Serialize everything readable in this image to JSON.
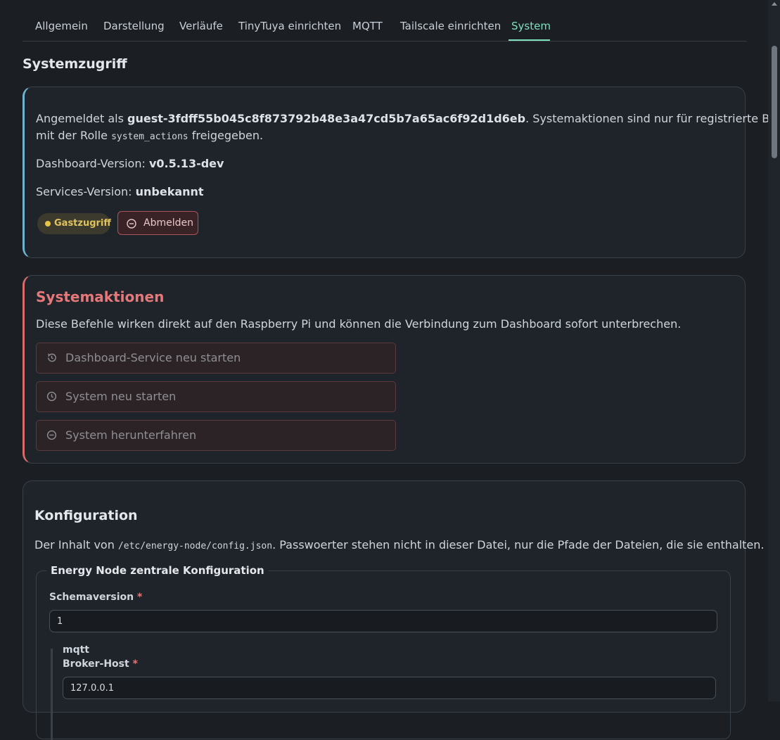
{
  "tabs": [
    {
      "label": "Allgemein",
      "active": false
    },
    {
      "label": "Darstellung",
      "active": false
    },
    {
      "label": "Verläufe",
      "active": false
    },
    {
      "label": "TinyTuya einrichten",
      "active": false
    },
    {
      "label": "MQTT",
      "active": false
    },
    {
      "label": "Tailscale einrichten",
      "active": false
    },
    {
      "label": "System",
      "active": true
    }
  ],
  "access": {
    "title": "Systemzugriff",
    "logged_in_prefix": "Angemeldet als ",
    "username": "guest-3fdff55b045c8f873792b48e3a47cd5b7a65ac6f92d1d6eb",
    "logged_in_suffix": ". Systemaktionen sind nur für registrierte Benutzer",
    "role_prefix": "mit der Rolle ",
    "role_name": "system_actions",
    "role_suffix": " freigegeben.",
    "dashboard_version_label": "Dashboard-Version: ",
    "dashboard_version": "v0.5.13-dev",
    "services_version_label": "Services-Version: ",
    "services_version": "unbekannt",
    "badge": "Gastzugriff",
    "logout_button": "Abmelden"
  },
  "actions": {
    "title": "Systemaktionen",
    "description": "Diese Befehle wirken direkt auf den Raspberry Pi und können die Verbindung zum Dashboard sofort unterbrechen.",
    "buttons": [
      {
        "label": "Dashboard-Service neu starten",
        "icon": "history-icon"
      },
      {
        "label": "System neu starten",
        "icon": "clock-icon"
      },
      {
        "label": "System herunterfahren",
        "icon": "minus-circle-icon"
      }
    ]
  },
  "config": {
    "title": "Konfiguration",
    "desc_prefix": "Der Inhalt von ",
    "path": "/etc/energy-node/config.json",
    "desc_suffix": ". Passwoerter stehen nicht in dieser Datei, nur die Pfade der Dateien, die sie enthalten.",
    "fieldset_legend": "Energy Node zentrale Konfiguration",
    "schema_label": "Schemaversion",
    "schema_value": "1",
    "mqtt_group": "mqtt",
    "broker_host_label": "Broker-Host",
    "broker_host_value": "127.0.0.1",
    "required_mark": "*"
  },
  "colors": {
    "accent": "#7fe0be",
    "danger": "#e6787a",
    "info_border": "#6fb3d2",
    "badge": "#e8c44a"
  }
}
